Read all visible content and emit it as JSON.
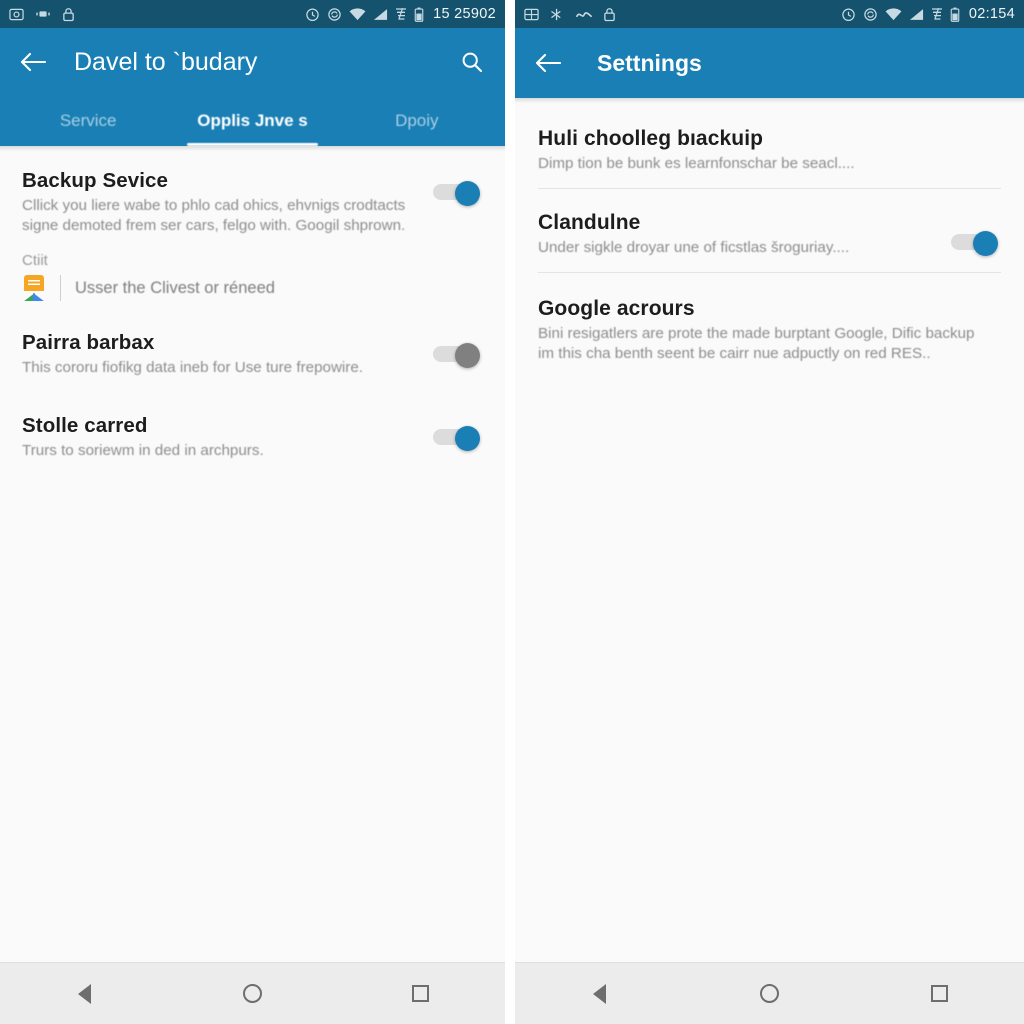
{
  "theme": {
    "status_bar_bg": "#15526d",
    "app_bar_bg": "#1a7fb5",
    "accent": "#1a7fb5",
    "content_bg": "#fafafa",
    "nav_bar_bg": "#ececec",
    "toggle_on": "#1a7fb5",
    "toggle_off": "#808080",
    "toggle_track": "#dcdcdc"
  },
  "left_panel": {
    "status_bar": {
      "left_icons": [
        "screenshot-icon",
        "vibrate-icon",
        "lock-icon"
      ],
      "right_icons": [
        "alarm-clock-icon",
        "sync-icon",
        "wifi-icon",
        "signal-icon",
        "cellular-data-icon",
        "battery-icon"
      ],
      "clock": "15 25902"
    },
    "app_bar": {
      "back_icon": "arrow-left-icon",
      "title": "Davel to `budary",
      "search_icon": "search-icon"
    },
    "tabs": [
      {
        "label": "Service",
        "active": false
      },
      {
        "label": "Opplis Jnve s",
        "active": true
      },
      {
        "label": "Dpoiy",
        "active": false
      }
    ],
    "items": [
      {
        "title": "Backup Sevice",
        "subtitle": "Cllick you liere wabe to phlo cad ohics, ehvnigs crodtacts signe demoted frem ser cars, felgo with. Googil shprown.",
        "toggle": "on"
      },
      {
        "title": "Pairra barbax",
        "subtitle": "This cororu fiofikg data ineb for Use ture frepowire.",
        "toggle": "off"
      },
      {
        "title": "Stolle carred",
        "subtitle": "Trurs to soriewm in ded in archpurs.",
        "toggle": "on"
      }
    ],
    "chip": {
      "label": "Ctiit",
      "icon": "google-drive-icon",
      "text": "Usser the Clivest or réneed"
    },
    "nav_bar": {
      "back": "nav-back-icon",
      "home": "nav-home-icon",
      "recents": "nav-recents-icon"
    }
  },
  "right_panel": {
    "status_bar": {
      "left_icons": [
        "screenshot-icon",
        "bluetooth-icon",
        "vibrate-icon",
        "lock-icon"
      ],
      "right_icons": [
        "alarm-clock-icon",
        "sync-icon",
        "wifi-icon",
        "signal-icon",
        "cellular-data-icon",
        "battery-icon"
      ],
      "clock": "02:154"
    },
    "app_bar": {
      "back_icon": "arrow-left-icon",
      "title": "Settnings"
    },
    "items": [
      {
        "title": "Huli choolleg bıackuip",
        "subtitle": "Dimp tion be bunk es learnfonschar be seacl....",
        "toggle": "none",
        "divider_after": true
      },
      {
        "title": "Clandulne",
        "subtitle": "Under sigkle droyar une of ficstlas šroguriay....",
        "toggle": "on",
        "divider_after": true
      },
      {
        "title": "Google acrours",
        "subtitle": "Bini resigatlers are prote the made burptant Google, Dific backup im this cha benth seent be cairr nue adpuctly on red RES..",
        "toggle": "none",
        "divider_after": false
      }
    ],
    "nav_bar": {
      "back": "nav-back-icon",
      "home": "nav-home-icon",
      "recents": "nav-recents-icon"
    }
  }
}
